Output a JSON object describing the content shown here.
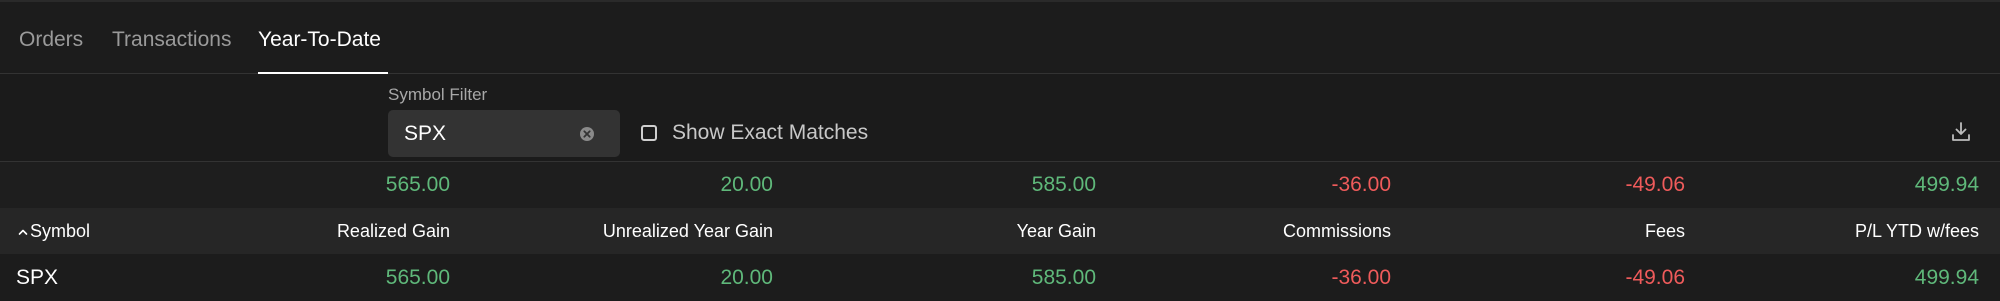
{
  "tabs": [
    {
      "label": "Orders",
      "active": false
    },
    {
      "label": "Transactions",
      "active": false
    },
    {
      "label": "Year-To-Date",
      "active": true
    }
  ],
  "filter": {
    "label": "Symbol Filter",
    "value": "SPX",
    "clear_icon": "close-circle-icon",
    "exact_matches_label": "Show Exact Matches",
    "exact_matches_checked": false,
    "download_icon": "download-icon"
  },
  "totals": {
    "realized_gain": "565.00",
    "unrealized_year_gain": "20.00",
    "year_gain": "585.00",
    "commissions": "-36.00",
    "fees": "-49.06",
    "pl_ytd_wfees": "499.94"
  },
  "columns": {
    "symbol": "Symbol",
    "realized_gain": "Realized Gain",
    "unrealized_year_gain": "Unrealized Year Gain",
    "year_gain": "Year Gain",
    "commissions": "Commissions",
    "fees": "Fees",
    "pl_ytd_wfees": "P/L YTD w/fees"
  },
  "sort": {
    "column": "symbol",
    "direction": "ascending",
    "icon": "chevron-up-icon"
  },
  "rows": [
    {
      "symbol": "SPX",
      "realized_gain": "565.00",
      "unrealized_year_gain": "20.00",
      "year_gain": "585.00",
      "commissions": "-36.00",
      "fees": "-49.06",
      "pl_ytd_wfees": "499.94"
    }
  ],
  "colors": {
    "positive": "#5fb87a",
    "negative": "#ef5b5b",
    "background": "#1e1e1e",
    "header_background": "#262626"
  }
}
